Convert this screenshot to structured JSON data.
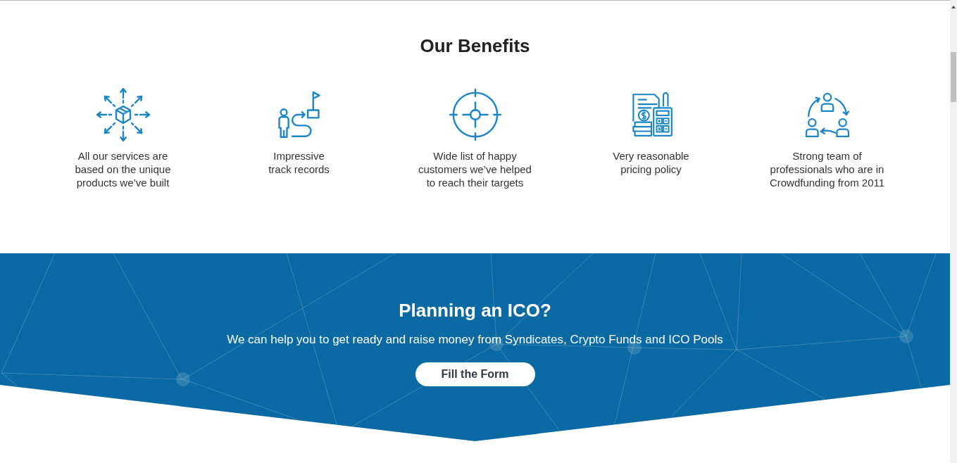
{
  "heading": "Our Benefits",
  "benefits": [
    {
      "text": "All our services are\nbased on the unique\nproducts we’ve built"
    },
    {
      "text": "Impressive\ntrack records"
    },
    {
      "text": "Wide list of happy\ncustomers we’ve helped\nto reach their targets"
    },
    {
      "text": "Very reasonable\npricing policy"
    },
    {
      "text": "Strong team of\nprofessionals who are in\nCrowdfunding from 2011"
    }
  ],
  "banner": {
    "title": "Planning an ICO?",
    "subtitle": "We can help you to get ready and raise money from Syndicates, Crypto Funds and ICO Pools",
    "button": "Fill the Form"
  }
}
